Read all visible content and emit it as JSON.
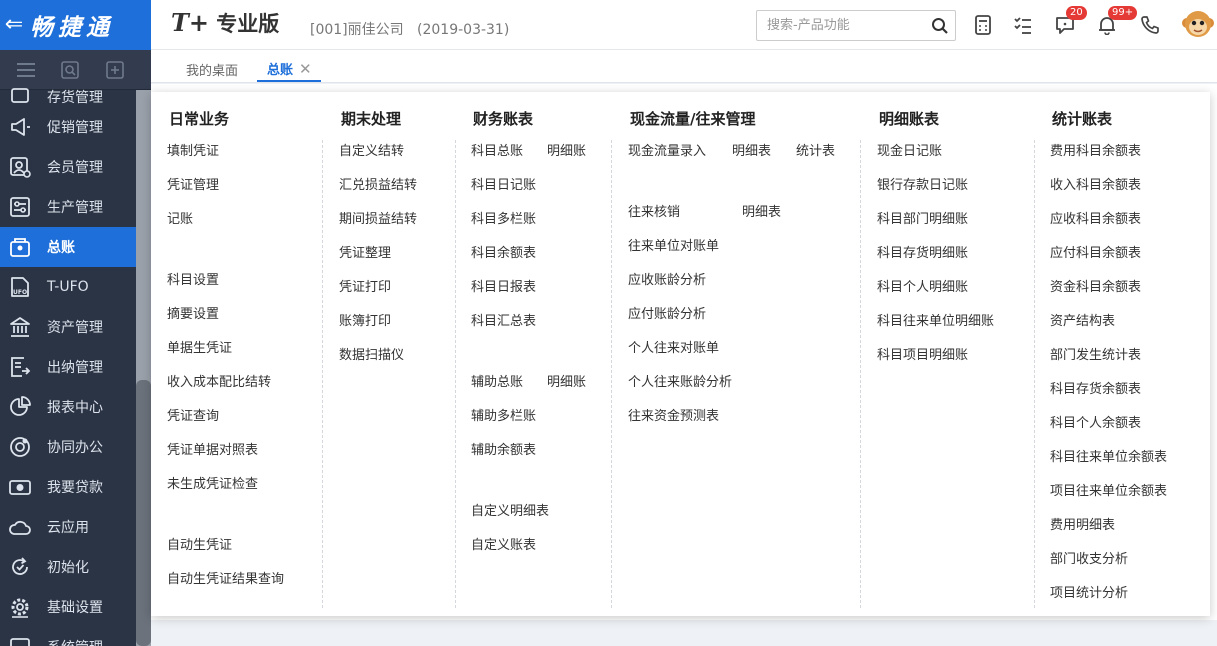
{
  "brand": {
    "logo_text": "畅捷通"
  },
  "sidebar": {
    "items": [
      {
        "label": "存货管理",
        "icon": "inventory-icon"
      },
      {
        "label": "促销管理",
        "icon": "promotion-icon"
      },
      {
        "label": "会员管理",
        "icon": "member-icon"
      },
      {
        "label": "生产管理",
        "icon": "production-icon"
      },
      {
        "label": "总账",
        "icon": "ledger-icon"
      },
      {
        "label": "T-UFO",
        "icon": "ufo-icon"
      },
      {
        "label": "资产管理",
        "icon": "asset-icon"
      },
      {
        "label": "出纳管理",
        "icon": "cashier-icon"
      },
      {
        "label": "报表中心",
        "icon": "report-icon"
      },
      {
        "label": "协同办公",
        "icon": "collab-icon"
      },
      {
        "label": "我要贷款",
        "icon": "loan-icon"
      },
      {
        "label": "云应用",
        "icon": "cloud-icon"
      },
      {
        "label": "初始化",
        "icon": "init-icon"
      },
      {
        "label": "基础设置",
        "icon": "settings-icon"
      },
      {
        "label": "系统管理",
        "icon": "system-icon"
      }
    ]
  },
  "topbar": {
    "product_prefix": "T+",
    "product_name": "专业版",
    "company": "[001]丽佳公司",
    "date": "(2019-03-31)",
    "search_placeholder": "搜索-产品功能",
    "messages_badge": "20",
    "notifications_badge": "99+"
  },
  "tabs": {
    "desktop": "我的桌面",
    "ledger": "总账",
    "close": "✕"
  },
  "menu": {
    "daily": {
      "title": "日常业务",
      "items": [
        "填制凭证",
        "凭证管理",
        "记账",
        "科目设置",
        "摘要设置",
        "单据生凭证",
        "收入成本配比结转",
        "凭证查询",
        "凭证单据对照表",
        "未生成凭证检查",
        "自动生凭证",
        "自动生凭证结果查询"
      ]
    },
    "period_end": {
      "title": "期末处理",
      "items": [
        "自定义结转",
        "汇兑损益结转",
        "期间损益结转",
        "凭证整理",
        "凭证打印",
        "账簿打印",
        "数据扫描仪"
      ]
    },
    "financial": {
      "title": "财务账表",
      "items": [
        "科目总账",
        "明细账",
        "科目日记账",
        "科目多栏账",
        "科目余额表",
        "科目日报表",
        "科目汇总表",
        "辅助总账",
        "明细账",
        "辅助多栏账",
        "辅助余额表",
        "自定义明细表",
        "自定义账表"
      ]
    },
    "cashflow": {
      "title": "现金流量/往来管理",
      "items": [
        "现金流量录入",
        "明细表",
        "统计表",
        "往来核销",
        "明细表",
        "往来单位对账单",
        "应收账龄分析",
        "应付账龄分析",
        "个人往来对账单",
        "个人往来账龄分析",
        "往来资金预测表"
      ]
    },
    "detail": {
      "title": "明细账表",
      "items": [
        "现金日记账",
        "银行存款日记账",
        "科目部门明细账",
        "科目存货明细账",
        "科目个人明细账",
        "科目往来单位明细账",
        "科目项目明细账"
      ]
    },
    "stats": {
      "title": "统计账表",
      "items": [
        "费用科目余额表",
        "收入科目余额表",
        "应收科目余额表",
        "应付科目余额表",
        "资金科目余额表",
        "资产结构表",
        "部门发生统计表",
        "科目存货余额表",
        "科目个人余额表",
        "科目往来单位余额表",
        "项目往来单位余额表",
        "费用明细表",
        "部门收支分析",
        "项目统计分析"
      ]
    }
  }
}
